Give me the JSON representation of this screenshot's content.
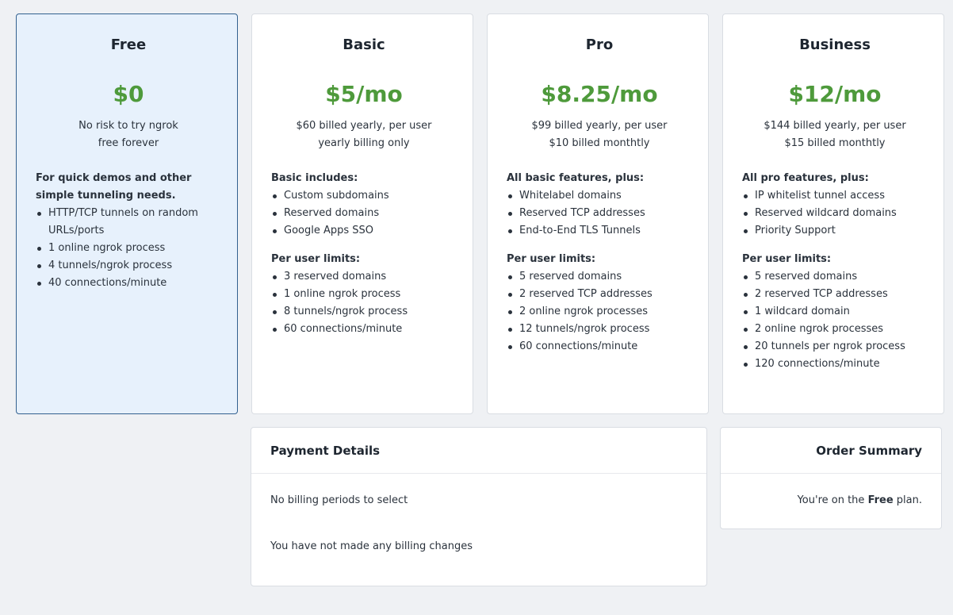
{
  "plans": [
    {
      "name": "Free",
      "price": "$0",
      "sub1": "No risk to try ngrok",
      "sub2": "free forever",
      "section1": "For quick demos and other simple tunneling needs.",
      "features": [
        "HTTP/TCP tunnels on random URLs/ports",
        "1 online ngrok process",
        "4 tunnels/ngrok process",
        "40 connections/minute"
      ]
    },
    {
      "name": "Basic",
      "price": "$5/mo",
      "sub1": "$60 billed yearly, per user",
      "sub2": "yearly billing only",
      "section1": "Basic includes:",
      "features": [
        "Custom subdomains",
        "Reserved domains",
        "Google Apps SSO"
      ],
      "limits_title": "Per user limits:",
      "limits": [
        "3 reserved domains",
        "1 online ngrok process",
        "8 tunnels/ngrok process",
        "60 connections/minute"
      ]
    },
    {
      "name": "Pro",
      "price": "$8.25/mo",
      "sub1": "$99 billed yearly, per user",
      "sub2": "$10 billed monthtly",
      "section1": "All basic features, plus:",
      "features": [
        "Whitelabel domains",
        "Reserved TCP addresses",
        "End-to-End TLS Tunnels"
      ],
      "limits_title": "Per user limits:",
      "limits": [
        "5 reserved domains",
        "2 reserved TCP addresses",
        "2 online ngrok processes",
        "12 tunnels/ngrok process",
        "60 connections/minute"
      ]
    },
    {
      "name": "Business",
      "price": "$12/mo",
      "sub1": "$144 billed yearly, per user",
      "sub2": "$15 billed monthtly",
      "section1": "All pro features, plus:",
      "features": [
        "IP whitelist tunnel access",
        "Reserved wildcard domains",
        "Priority Support"
      ],
      "limits_title": "Per user limits:",
      "limits": [
        "5 reserved domains",
        "2 reserved TCP addresses",
        "1 wildcard domain",
        "2 online ngrok processes",
        "20 tunnels per ngrok process",
        "120 connections/minute"
      ]
    }
  ],
  "payment": {
    "title": "Payment Details",
    "no_periods": "No billing periods to select",
    "no_changes": "You have not made any billing changes"
  },
  "summary": {
    "title": "Order Summary",
    "prefix": "You're on the ",
    "plan": "Free",
    "suffix": " plan."
  },
  "colors": {
    "price_green": "#4e9a3b",
    "selected_bg": "#e7f1fc",
    "selected_border": "#33618f",
    "page_bg": "#eff1f4"
  }
}
